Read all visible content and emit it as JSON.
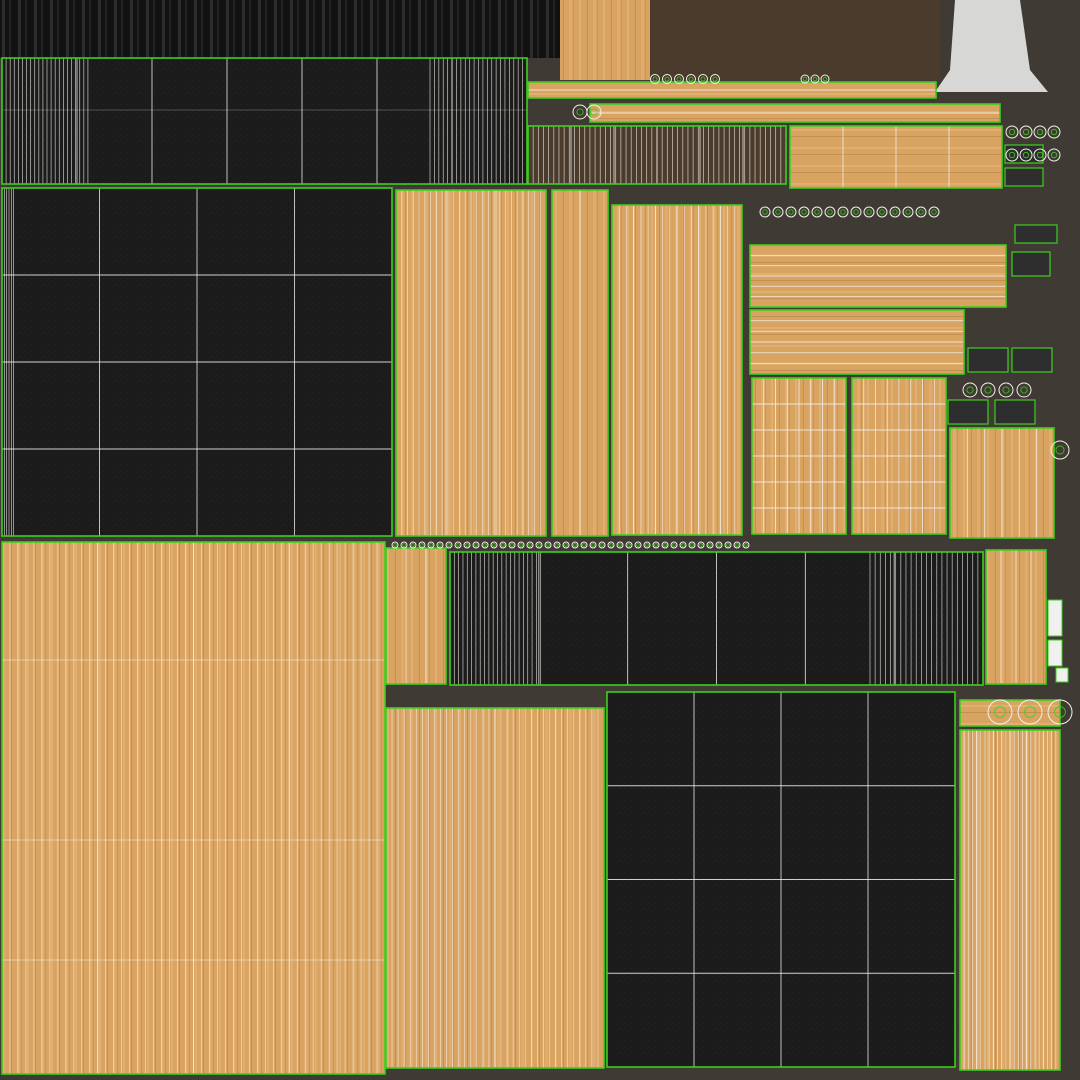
{
  "colors": {
    "background": "#3f3a33",
    "cloth": "#1b1b1b",
    "cloth_dark": "#121212",
    "wood": "#d9a362",
    "wood_light": "#e6b87a",
    "wood_dark": "#9c6a37",
    "seam": "#3ecf1e",
    "wire": "#f4f1ea",
    "drape": "#d7d7d5",
    "shadow": "#4a3b2d"
  },
  "icons": [
    "circle-marker-icon",
    "gear-marker-icon"
  ]
}
